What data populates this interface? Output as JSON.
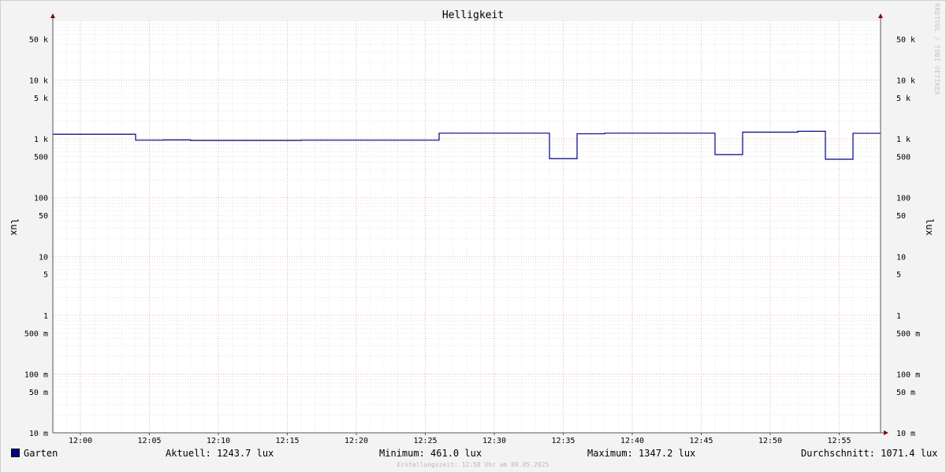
{
  "chart_data": {
    "type": "line",
    "title": "Helligkeit",
    "ylabel_left": "lux",
    "ylabel_right": "lux",
    "y_scale": "log",
    "ylim": [
      0.01,
      100000
    ],
    "x_tick_labels": [
      "12:00",
      "12:05",
      "12:10",
      "12:15",
      "12:20",
      "12:25",
      "12:30",
      "12:35",
      "12:40",
      "12:45",
      "12:50",
      "12:55"
    ],
    "y_tick_labels": [
      {
        "value": 50000,
        "label": "50 k"
      },
      {
        "value": 10000,
        "label": "10 k"
      },
      {
        "value": 5000,
        "label": "5 k"
      },
      {
        "value": 1000,
        "label": "1 k"
      },
      {
        "value": 500,
        "label": "500"
      },
      {
        "value": 100,
        "label": "100"
      },
      {
        "value": 50,
        "label": "50"
      },
      {
        "value": 10,
        "label": "10"
      },
      {
        "value": 5,
        "label": "5"
      },
      {
        "value": 1,
        "label": "1"
      },
      {
        "value": 0.5,
        "label": "500 m"
      },
      {
        "value": 0.1,
        "label": "100 m"
      },
      {
        "value": 0.05,
        "label": "50 m"
      },
      {
        "value": 0.01,
        "label": "10 m"
      }
    ],
    "grid": true,
    "series": [
      {
        "name": "Garten",
        "color": "#00008b",
        "step_points": [
          [
            "11:58",
            1200
          ],
          [
            "12:04",
            950
          ],
          [
            "12:06",
            960
          ],
          [
            "12:08",
            940
          ],
          [
            "12:16",
            950
          ],
          [
            "12:20",
            950
          ],
          [
            "12:26",
            1250
          ],
          [
            "12:34",
            461
          ],
          [
            "12:36",
            1220
          ],
          [
            "12:38",
            1250
          ],
          [
            "12:46",
            540
          ],
          [
            "12:48",
            1300
          ],
          [
            "12:52",
            1347.2
          ],
          [
            "12:54",
            450
          ],
          [
            "12:56",
            1243.7
          ],
          [
            "12:58",
            1243.7
          ]
        ]
      }
    ]
  },
  "legend": {
    "series_name": "Garten",
    "aktuell": "Aktuell: 1243.7 lux",
    "minimum": "Minimum: 461.0 lux",
    "maximum": "Maximum: 1347.2 lux",
    "durchschnitt": "Durchschnitt: 1071.4 lux"
  },
  "footer": "Erstellungszeit: 12:58 Uhr am 09.05.2025",
  "watermark": "RRDTOOL / TOBI OETIKER"
}
